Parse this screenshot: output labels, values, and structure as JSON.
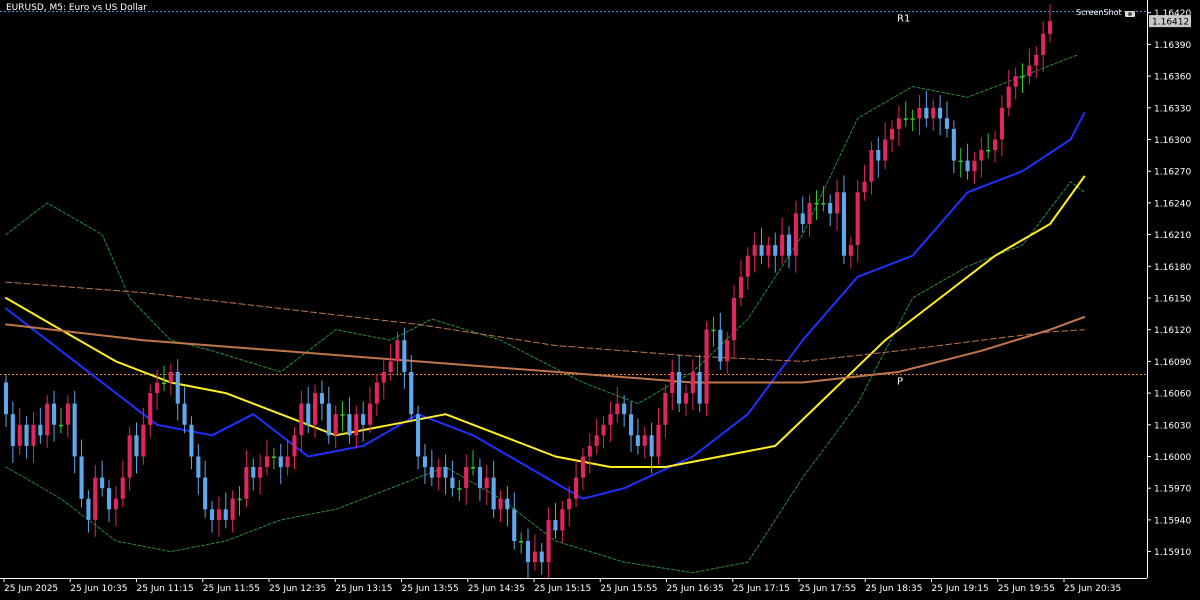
{
  "window": {
    "title": "EURUSD, M5:  Euro vs US Dollar",
    "screenshot_label": "ScreenShot"
  },
  "chart_data": {
    "type": "candlestick",
    "symbol": "EURUSD",
    "timeframe": "M5",
    "ylim": [
      1.15885,
      1.16432
    ],
    "y_ticks": [
      "1.16420",
      "1.16390",
      "1.16360",
      "1.16330",
      "1.16300",
      "1.16270",
      "1.16240",
      "1.16210",
      "1.16180",
      "1.16150",
      "1.16120",
      "1.16090",
      "1.16060",
      "1.16030",
      "1.16000",
      "1.15970",
      "1.15940",
      "1.15910"
    ],
    "x_labels": [
      "25 Jun 2025",
      "25 Jun 10:35",
      "25 Jun 11:15",
      "25 Jun 11:55",
      "25 Jun 12:35",
      "25 Jun 13:15",
      "25 Jun 13:55",
      "25 Jun 14:35",
      "25 Jun 15:15",
      "25 Jun 15:55",
      "25 Jun 16:35",
      "25 Jun 17:15",
      "25 Jun 17:55",
      "25 Jun 18:35",
      "25 Jun 19:15",
      "25 Jun 19:55",
      "25 Jun 20:35"
    ],
    "current_price": "1.16412",
    "levels": [
      {
        "label": "R1",
        "price": 1.16422,
        "color": "#4a8fd8"
      },
      {
        "label": "P",
        "price": 1.16078,
        "color": "#e8822a"
      }
    ],
    "colors": {
      "bull": "#e0265c",
      "bear": "#5fa8ee",
      "doji": "#33cc33",
      "ma_fast": "#1f30ff",
      "ma_mid": "#ffee22",
      "ma_slow": "#c0764a",
      "bollinger": "#2a8a3a",
      "axis": "#ffffff"
    },
    "candles": {
      "open": [
        1.1607,
        1.1604,
        1.1601,
        1.1603,
        1.1601,
        1.1603,
        1.1602,
        1.1605,
        1.1603,
        1.1603,
        1.1605,
        1.16,
        1.1596,
        1.1594,
        1.1598,
        1.1597,
        1.1595,
        1.1596,
        1.1598,
        1.1602,
        1.16,
        1.1603,
        1.1606,
        1.1607,
        1.1607,
        1.1608,
        1.1605,
        1.1603,
        1.16,
        1.1598,
        1.1595,
        1.1594,
        1.1595,
        1.1594,
        1.1596,
        1.1596,
        1.1599,
        1.1598,
        1.1599,
        1.16,
        1.16,
        1.1599,
        1.16,
        1.1602,
        1.1605,
        1.1603,
        1.1606,
        1.1605,
        1.1602,
        1.1604,
        1.1604,
        1.1602,
        1.1604,
        1.1603,
        1.1605,
        1.1607,
        1.1608,
        1.1609,
        1.1611,
        1.1608,
        1.1604,
        1.16,
        1.1599,
        1.1598,
        1.1599,
        1.1598,
        1.1597,
        1.1597,
        1.1599,
        1.1599,
        1.1597,
        1.1598,
        1.1595,
        1.1596,
        1.1595,
        1.1592,
        1.1592,
        1.159,
        1.1591,
        1.159,
        1.1594,
        1.1593,
        1.1595,
        1.1596,
        1.1598,
        1.16,
        1.1601,
        1.1602,
        1.1603,
        1.1604,
        1.1605,
        1.1604,
        1.1602,
        1.1601,
        1.1602,
        1.16,
        1.1603,
        1.1606,
        1.1608,
        1.1605,
        1.1606,
        1.1608,
        1.1605,
        1.1612,
        1.1612,
        1.1609,
        1.1611,
        1.1615,
        1.1617,
        1.1619,
        1.162,
        1.1619,
        1.162,
        1.1619,
        1.1621,
        1.1619,
        1.1623,
        1.1622,
        1.1624,
        1.1624,
        1.1624,
        1.1623,
        1.1625,
        1.1619,
        1.162,
        1.1625,
        1.1626,
        1.1629,
        1.1628,
        1.163,
        1.1631,
        1.1632,
        1.1632,
        1.1632,
        1.1633,
        1.1632,
        1.1633,
        1.1632,
        1.1631,
        1.1628,
        1.1628,
        1.1627,
        1.1628,
        1.1629,
        1.1629,
        1.163,
        1.1633,
        1.1635,
        1.1636,
        1.1636,
        1.1637,
        1.1638,
        1.164
      ],
      "close": [
        1.1604,
        1.1601,
        1.1603,
        1.1601,
        1.1603,
        1.1602,
        1.1605,
        1.1603,
        1.1603,
        1.1605,
        1.16,
        1.1596,
        1.1594,
        1.1598,
        1.1597,
        1.1595,
        1.1596,
        1.1598,
        1.1602,
        1.16,
        1.1603,
        1.1606,
        1.1607,
        1.1607,
        1.1608,
        1.1605,
        1.1603,
        1.16,
        1.1598,
        1.1595,
        1.1594,
        1.1595,
        1.1594,
        1.1596,
        1.1596,
        1.1599,
        1.1598,
        1.1599,
        1.16,
        1.16,
        1.1599,
        1.16,
        1.1602,
        1.1605,
        1.1603,
        1.1606,
        1.1605,
        1.1602,
        1.1604,
        1.1604,
        1.1602,
        1.1604,
        1.1603,
        1.1605,
        1.1607,
        1.1608,
        1.1609,
        1.1611,
        1.1608,
        1.1604,
        1.16,
        1.1599,
        1.1598,
        1.1599,
        1.1598,
        1.1597,
        1.1597,
        1.1599,
        1.1599,
        1.1597,
        1.1598,
        1.1595,
        1.1596,
        1.1595,
        1.1592,
        1.1592,
        1.159,
        1.1591,
        1.159,
        1.1594,
        1.1593,
        1.1595,
        1.1596,
        1.1598,
        1.16,
        1.1601,
        1.1602,
        1.1603,
        1.1604,
        1.1605,
        1.1604,
        1.1602,
        1.1601,
        1.1602,
        1.16,
        1.1603,
        1.1606,
        1.1608,
        1.1605,
        1.1606,
        1.1608,
        1.1605,
        1.1612,
        1.1612,
        1.1609,
        1.1611,
        1.1615,
        1.1617,
        1.1619,
        1.162,
        1.1619,
        1.162,
        1.1619,
        1.1621,
        1.1619,
        1.1623,
        1.1622,
        1.1624,
        1.1624,
        1.1624,
        1.1623,
        1.1625,
        1.1619,
        1.162,
        1.1625,
        1.1626,
        1.1629,
        1.1628,
        1.163,
        1.1631,
        1.1632,
        1.1632,
        1.1632,
        1.1633,
        1.1632,
        1.1633,
        1.1632,
        1.1631,
        1.1628,
        1.1628,
        1.1627,
        1.1628,
        1.1629,
        1.1629,
        1.163,
        1.1633,
        1.1635,
        1.1636,
        1.1636,
        1.1637,
        1.1638,
        1.164,
        1.16412
      ]
    },
    "series": [
      {
        "type": "moving_average",
        "color": "#1f30ff",
        "points": [
          [
            0,
            1.1614
          ],
          [
            6,
            1.1611
          ],
          [
            14,
            1.1607
          ],
          [
            22,
            1.1603
          ],
          [
            30,
            1.1602
          ],
          [
            36,
            1.1604
          ],
          [
            44,
            1.16
          ],
          [
            52,
            1.1601
          ],
          [
            60,
            1.1604
          ],
          [
            68,
            1.1602
          ],
          [
            76,
            1.1599
          ],
          [
            84,
            1.1596
          ],
          [
            90,
            1.1597
          ],
          [
            100,
            1.16
          ],
          [
            108,
            1.1604
          ],
          [
            116,
            1.1611
          ],
          [
            124,
            1.1617
          ],
          [
            132,
            1.1619
          ],
          [
            140,
            1.1625
          ],
          [
            148,
            1.1627
          ],
          [
            155,
            1.163
          ],
          [
            157,
            1.16325
          ]
        ]
      },
      {
        "type": "moving_average",
        "color": "#ffee22",
        "points": [
          [
            0,
            1.1615
          ],
          [
            8,
            1.1612
          ],
          [
            16,
            1.1609
          ],
          [
            24,
            1.1607
          ],
          [
            32,
            1.1606
          ],
          [
            40,
            1.1604
          ],
          [
            48,
            1.1602
          ],
          [
            56,
            1.1603
          ],
          [
            64,
            1.1604
          ],
          [
            72,
            1.1602
          ],
          [
            80,
            1.16
          ],
          [
            88,
            1.1599
          ],
          [
            96,
            1.1599
          ],
          [
            104,
            1.16
          ],
          [
            112,
            1.1601
          ],
          [
            120,
            1.1606
          ],
          [
            128,
            1.1611
          ],
          [
            136,
            1.1615
          ],
          [
            144,
            1.1619
          ],
          [
            152,
            1.1622
          ],
          [
            157,
            1.16265
          ]
        ]
      },
      {
        "type": "moving_average",
        "color": "#c0764a",
        "points": [
          [
            0,
            1.16125
          ],
          [
            20,
            1.1611
          ],
          [
            40,
            1.161
          ],
          [
            60,
            1.1609
          ],
          [
            80,
            1.1608
          ],
          [
            100,
            1.1607
          ],
          [
            116,
            1.1607
          ],
          [
            130,
            1.1608
          ],
          [
            142,
            1.161
          ],
          [
            152,
            1.1612
          ],
          [
            157,
            1.16132
          ]
        ]
      },
      {
        "type": "moving_average",
        "color": "#c0764a",
        "points": [
          [
            0,
            1.16165
          ],
          [
            20,
            1.16155
          ],
          [
            40,
            1.1614
          ],
          [
            60,
            1.16125
          ],
          [
            80,
            1.16105
          ],
          [
            100,
            1.16095
          ],
          [
            116,
            1.1609
          ],
          [
            130,
            1.161
          ],
          [
            142,
            1.1611
          ],
          [
            152,
            1.16118
          ],
          [
            157,
            1.1612
          ]
        ]
      },
      {
        "type": "bollinger_upper",
        "color": "#2a8a3a",
        "points": [
          [
            0,
            1.1621
          ],
          [
            6,
            1.1624
          ],
          [
            14,
            1.1621
          ],
          [
            18,
            1.1615
          ],
          [
            24,
            1.1611
          ],
          [
            30,
            1.161
          ],
          [
            40,
            1.1608
          ],
          [
            48,
            1.1612
          ],
          [
            56,
            1.1611
          ],
          [
            62,
            1.1613
          ],
          [
            72,
            1.1611
          ],
          [
            84,
            1.1607
          ],
          [
            92,
            1.1605
          ],
          [
            100,
            1.1608
          ],
          [
            108,
            1.1613
          ],
          [
            116,
            1.1621
          ],
          [
            124,
            1.1632
          ],
          [
            132,
            1.1635
          ],
          [
            140,
            1.1634
          ],
          [
            148,
            1.1636
          ],
          [
            156,
            1.1638
          ]
        ]
      },
      {
        "type": "bollinger_lower",
        "color": "#2a8a3a",
        "points": [
          [
            0,
            1.1599
          ],
          [
            8,
            1.1596
          ],
          [
            16,
            1.1592
          ],
          [
            24,
            1.1591
          ],
          [
            32,
            1.1592
          ],
          [
            40,
            1.1594
          ],
          [
            48,
            1.1595
          ],
          [
            56,
            1.1597
          ],
          [
            64,
            1.1599
          ],
          [
            72,
            1.1596
          ],
          [
            80,
            1.1592
          ],
          [
            90,
            1.159
          ],
          [
            100,
            1.1589
          ],
          [
            108,
            1.159
          ],
          [
            116,
            1.1598
          ],
          [
            124,
            1.1605
          ],
          [
            132,
            1.1615
          ],
          [
            140,
            1.1618
          ],
          [
            148,
            1.162
          ],
          [
            155,
            1.1626
          ],
          [
            157,
            1.1625
          ]
        ]
      }
    ]
  }
}
